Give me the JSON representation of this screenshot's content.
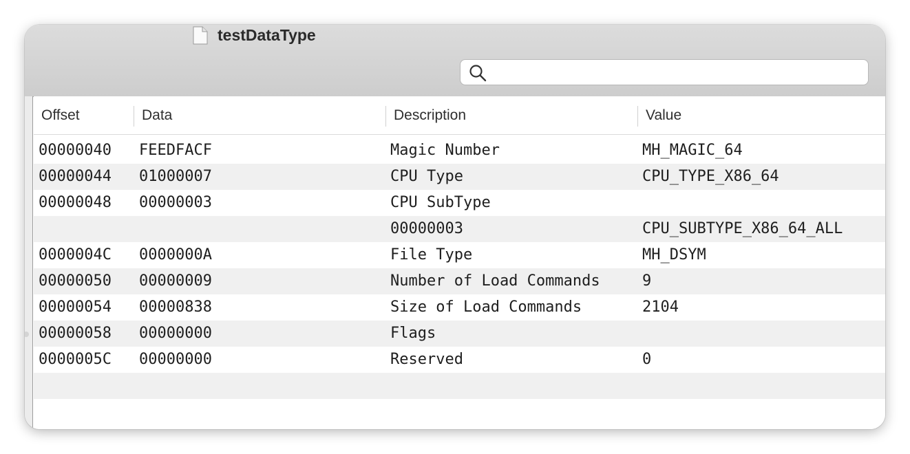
{
  "window": {
    "title": "testDataType"
  },
  "search": {
    "value": "",
    "placeholder": ""
  },
  "table": {
    "columns": [
      "Offset",
      "Data",
      "Description",
      "Value"
    ],
    "rows": [
      {
        "offset": "00000040",
        "data": "FEEDFACF",
        "description": "Magic Number",
        "value": "MH_MAGIC_64"
      },
      {
        "offset": "00000044",
        "data": "01000007",
        "description": "CPU Type",
        "value": "CPU_TYPE_X86_64"
      },
      {
        "offset": "00000048",
        "data": "00000003",
        "description": "CPU SubType",
        "value": ""
      },
      {
        "offset": "",
        "data": "",
        "description": "00000003",
        "value": "CPU_SUBTYPE_X86_64_ALL"
      },
      {
        "offset": "0000004C",
        "data": "0000000A",
        "description": "File Type",
        "value": "MH_DSYM"
      },
      {
        "offset": "00000050",
        "data": "00000009",
        "description": "Number of Load Commands",
        "value": "9"
      },
      {
        "offset": "00000054",
        "data": "00000838",
        "description": "Size of Load Commands",
        "value": "2104"
      },
      {
        "offset": "00000058",
        "data": "00000000",
        "description": "Flags",
        "value": ""
      },
      {
        "offset": "0000005C",
        "data": "00000000",
        "description": "Reserved",
        "value": "0"
      },
      {
        "offset": "",
        "data": "",
        "description": "",
        "value": ""
      }
    ]
  },
  "icons": {
    "document": "document-icon",
    "search": "search-icon"
  },
  "colors": {
    "titlebar": "#d4d4d4",
    "row_alt": "#f0f0f0",
    "text": "#1e1e1e"
  }
}
